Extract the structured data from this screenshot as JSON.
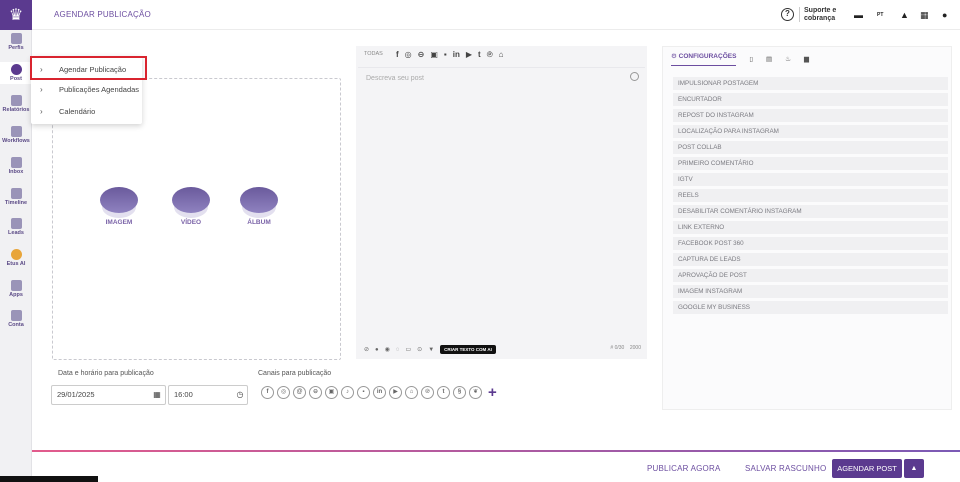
{
  "header": {
    "title": "AGENDAR PUBLICAÇÃO",
    "support_line1": "Suporte e",
    "support_line2": "cobrança",
    "lang": "PT"
  },
  "sidebar": {
    "items": [
      {
        "label": "Perfis",
        "icon": "user-icon"
      },
      {
        "label": "Post",
        "icon": "clock-icon"
      },
      {
        "label": "Relatórios",
        "icon": "pie-chart-icon"
      },
      {
        "label": "Workflows",
        "icon": "sitemap-icon"
      },
      {
        "label": "Inbox",
        "icon": "chat-icon"
      },
      {
        "label": "Timeline",
        "icon": "grid-icon"
      },
      {
        "label": "Leads",
        "icon": "filter-icon"
      },
      {
        "label": "Etus AI",
        "icon": "ai-icon"
      },
      {
        "label": "Apps",
        "icon": "apps-icon"
      },
      {
        "label": "Conta",
        "icon": "gear-icon"
      }
    ]
  },
  "submenu": {
    "items": [
      {
        "label": "Agendar Publicação"
      },
      {
        "label": "Publicações Agendadas"
      },
      {
        "label": "Calendário"
      }
    ]
  },
  "media": {
    "options": [
      {
        "label": "IMAGEM"
      },
      {
        "label": "VÍDEO"
      },
      {
        "label": "ÁLBUM"
      }
    ]
  },
  "editor": {
    "all_tab": "TODAS",
    "placeholder": "Descreva seu post",
    "ai_button": "CRIAR TEXTO COM AI",
    "counter": "# 0/30",
    "char_limit": "2000"
  },
  "settings": {
    "tab_label": "CONFIGURAÇÕES",
    "items": [
      "IMPULSIONAR POSTAGEM",
      "ENCURTADOR",
      "REPOST DO INSTAGRAM",
      "LOCALIZAÇÃO PARA INSTAGRAM",
      "POST COLLAB",
      "PRIMEIRO COMENTÁRIO",
      "IGTV",
      "REELS",
      "DESABILITAR COMENTÁRIO INSTAGRAM",
      "LINK EXTERNO",
      "FACEBOOK POST 360",
      "CAPTURA DE LEADS",
      "APROVAÇÃO DE POST",
      "IMAGEM INSTAGRAM",
      "GOOGLE MY BUSINESS"
    ]
  },
  "schedule": {
    "datetime_label": "Data e horário para publicação",
    "date_value": "29/01/2025",
    "time_value": "16:00",
    "channels_label": "Canais para publicação"
  },
  "footer": {
    "publish_now": "PUBLICAR AGORA",
    "save_draft": "SALVAR RASCUNHO",
    "schedule_post": "AGENDAR POST"
  },
  "colors": {
    "brand": "#5b3a8f",
    "highlight": "#d9242f"
  }
}
